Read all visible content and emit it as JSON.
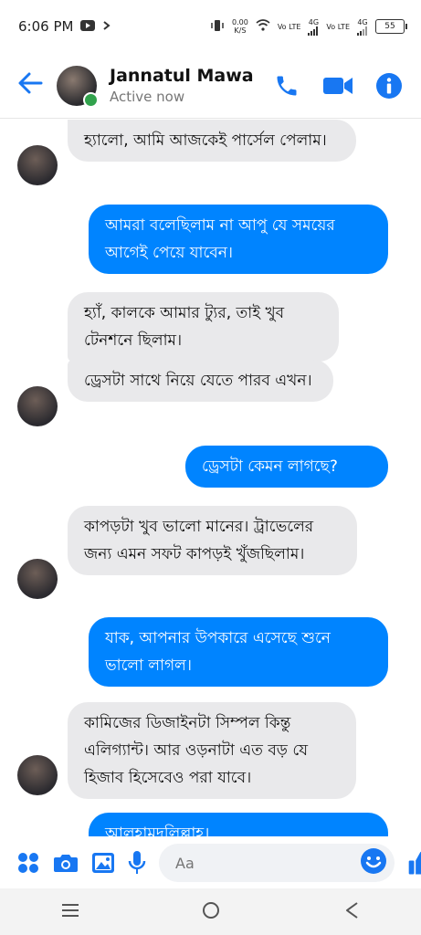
{
  "status_bar": {
    "time": "6:06 PM",
    "net_speed": "0.00",
    "net_unit": "K/S",
    "sim1": "Vo LTE",
    "sim1_net": "4G",
    "sim2": "Vo LTE",
    "sim2_net": "4G",
    "battery": "55"
  },
  "header": {
    "name": "Jannatul Mawa",
    "status": "Active now"
  },
  "messages": [
    {
      "side": "in",
      "text": "হ্যালো, আমি আজকেই পার্সেল পেলাম।"
    },
    {
      "side": "out",
      "text": "আমরা বলেছিলাম না আপু যে সময়ের আগেই পেয়ে যাবেন।"
    },
    {
      "side": "in",
      "text": "হ্যাঁ, কালকে আমার ট্যুর, তাই খুব টেনশনে ছিলাম।"
    },
    {
      "side": "in",
      "text": "ড্রেসটা সাথে নিয়ে যেতে পারব এখন।"
    },
    {
      "side": "out",
      "text": "ড্রেসটা কেমন লাগছে?"
    },
    {
      "side": "in",
      "text": "কাপড়টা খুব ভালো মানের। ট্রাভেলের জন্য এমন সফট কাপড়ই খুঁজছিলাম।"
    },
    {
      "side": "out",
      "text": "যাক, আপনার উপকারে এসেছে শুনে ভালো লাগল।"
    },
    {
      "side": "in",
      "text": "কামিজের ডিজাইনটা সিম্পল কিন্তু এলিগ্যান্ট। আর ওড়নাটা এত বড় যে হিজাব হিসেবেও পরা যাবে।"
    },
    {
      "side": "out",
      "text": "আলহামদুলিল্লাহ।"
    }
  ],
  "composer": {
    "placeholder": "Aa"
  },
  "colors": {
    "accent": "#1877f2",
    "outgoing_bubble": "#0084ff",
    "incoming_bubble": "#e9e9eb"
  }
}
